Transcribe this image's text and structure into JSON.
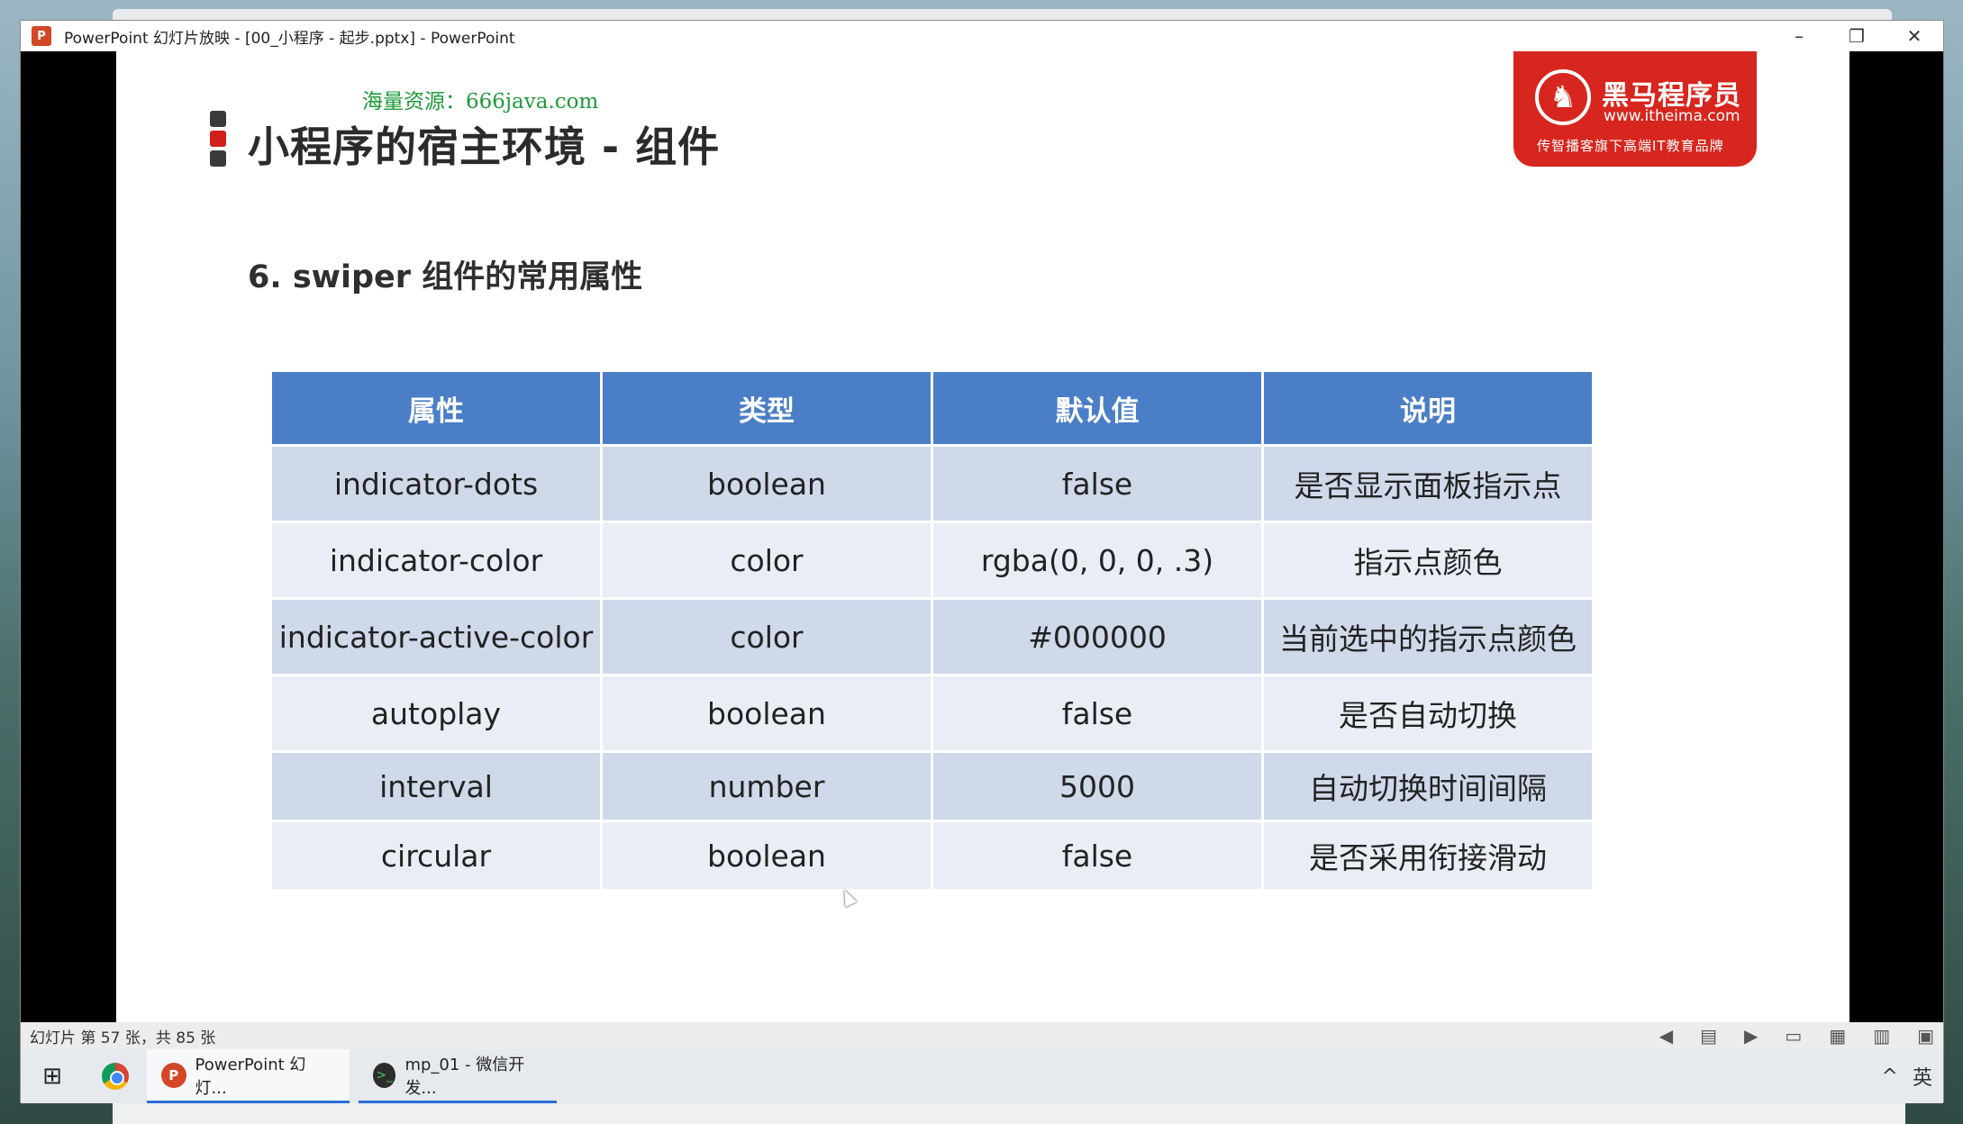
{
  "window": {
    "title": "PowerPoint 幻灯片放映 - [00_小程序 - 起步.pptx] - PowerPoint",
    "app_icon": "P",
    "controls": {
      "minimize": "–",
      "restore": "❐",
      "close": "✕"
    }
  },
  "slide": {
    "watermark": "海量资源：666java.com",
    "title": "小程序的宿主环境 - 组件",
    "subtitle": "6. swiper 组件的常用属性",
    "bullet_colors": [
      "#3a3a3a",
      "#d21f1a",
      "#3a3a3a"
    ],
    "logo": {
      "name": "黑马程序员",
      "url": "www.itheima.com",
      "slogan": "传智播客旗下高端IT教育品牌"
    },
    "table": {
      "headers": [
        "属性",
        "类型",
        "默认值",
        "说明"
      ],
      "rows": [
        [
          "indicator-dots",
          "boolean",
          "false",
          "是否显示面板指示点"
        ],
        [
          "indicator-color",
          "color",
          "rgba(0, 0, 0, .3)",
          "指示点颜色"
        ],
        [
          "indicator-active-color",
          "color",
          "#000000",
          "当前选中的指示点颜色"
        ],
        [
          "autoplay",
          "boolean",
          "false",
          "是否自动切换"
        ],
        [
          "interval",
          "number",
          "5000",
          "自动切换时间间隔"
        ],
        [
          "circular",
          "boolean",
          "false",
          "是否采用衔接滑动"
        ]
      ]
    },
    "colors": {
      "header_bg": "#4a7ec6",
      "accent_red": "#d21f1a"
    }
  },
  "statusbar": {
    "text": "幻灯片 第 57 张，共 85 张"
  },
  "taskbar": {
    "start_icon": "windows-icon",
    "apps": [
      {
        "label": "PowerPoint 幻灯...",
        "icon": "P"
      },
      {
        "label": "mp_01 - 微信开发...",
        "icon": ">_"
      }
    ],
    "tray_chevron": "^",
    "ime_label": "英"
  }
}
